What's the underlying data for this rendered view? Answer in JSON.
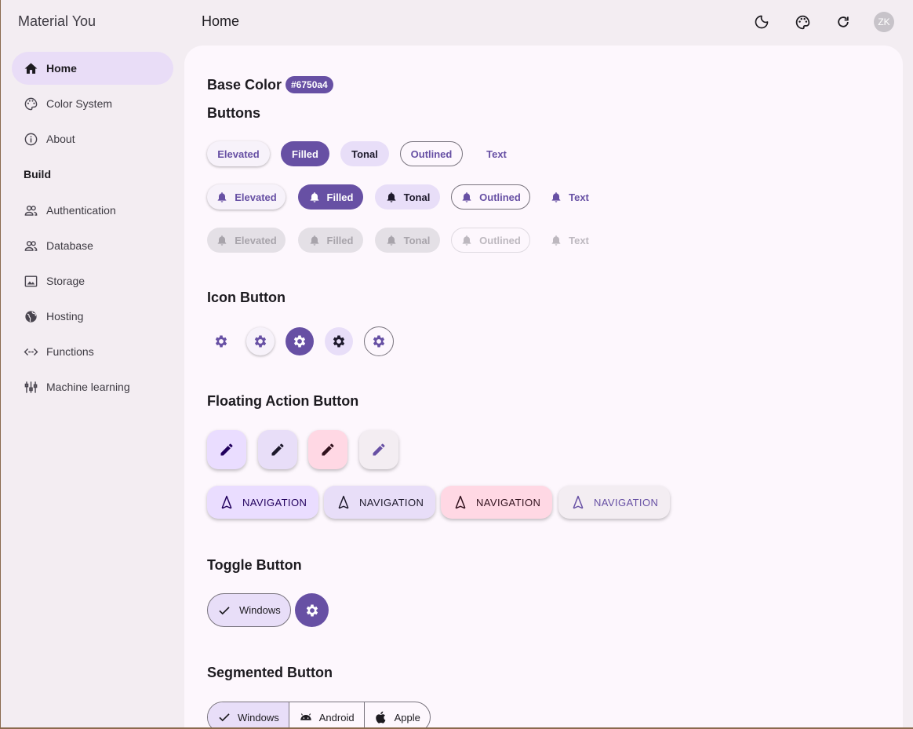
{
  "app": {
    "title": "Material You",
    "page_title": "Home",
    "avatar_initials": "ZK"
  },
  "sidebar": {
    "items": [
      {
        "label": "Home",
        "icon": "home-icon"
      },
      {
        "label": "Color System",
        "icon": "palette-icon"
      },
      {
        "label": "About",
        "icon": "info-icon"
      }
    ],
    "section": "Build",
    "build_items": [
      {
        "label": "Authentication",
        "icon": "people-icon"
      },
      {
        "label": "Database",
        "icon": "people-icon"
      },
      {
        "label": "Storage",
        "icon": "image-icon"
      },
      {
        "label": "Hosting",
        "icon": "globe-icon"
      },
      {
        "label": "Functions",
        "icon": "code-arrows-icon"
      },
      {
        "label": "Machine learning",
        "icon": "sliders-icon"
      }
    ]
  },
  "main": {
    "base_color_label": "Base Color",
    "base_color_value": "#6750a4",
    "buttons_heading": "Buttons",
    "buttons": {
      "elevated": "Elevated",
      "filled": "Filled",
      "tonal": "Tonal",
      "outlined": "Outlined",
      "text": "Text"
    },
    "icon_button_heading": "Icon Button",
    "fab_heading": "Floating Action Button",
    "fab_extended_label": "NAVIGATION",
    "toggle_heading": "Toggle Button",
    "toggle_label": "Windows",
    "segmented_heading": "Segmented Button",
    "segments": [
      "Windows",
      "Android",
      "Apple"
    ]
  },
  "colors": {
    "primary": "#6750a4",
    "primary_container": "#e8def8",
    "tertiary_container": "#ffd8e4",
    "surface": "#fdf7fd"
  }
}
